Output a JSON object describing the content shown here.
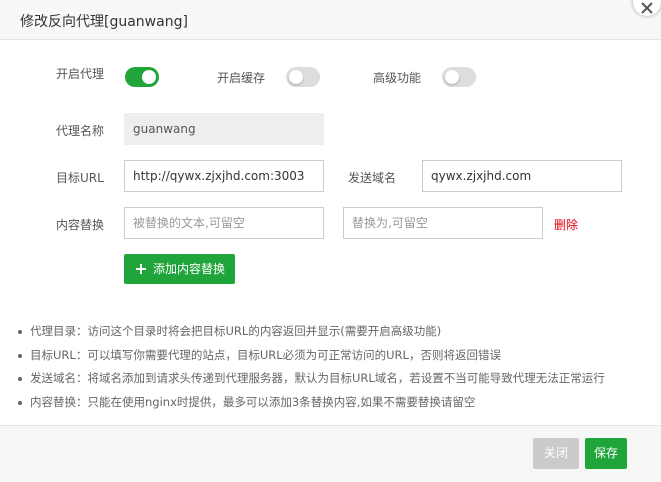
{
  "dialog": {
    "title": "修改反向代理[guanwang]"
  },
  "form": {
    "enable_proxy": {
      "label": "开启代理",
      "on": true
    },
    "enable_cache": {
      "label": "开启缓存",
      "on": false
    },
    "advanced": {
      "label": "高级功能",
      "on": false
    },
    "proxy_name": {
      "label": "代理名称",
      "value": "guanwang"
    },
    "target_url": {
      "label": "目标URL",
      "value": "http://qywx.zjxjhd.com:3003"
    },
    "send_domain": {
      "label": "发送域名",
      "value": "qywx.zjxjhd.com"
    },
    "content_replace": {
      "label": "内容替换",
      "source_placeholder": "被替换的文本,可留空",
      "target_placeholder": "替换为,可留空",
      "delete_label": "删除"
    },
    "add_button_label": "添加内容替换"
  },
  "notes": [
    "代理目录：访问这个目录时将会把目标URL的内容返回并显示(需要开启高级功能)",
    "目标URL：可以填写你需要代理的站点，目标URL必须为可正常访问的URL，否则将返回错误",
    "发送域名：将域名添加到请求头传递到代理服务器，默认为目标URL域名，若设置不当可能导致代理无法正常运行",
    "内容替换：只能在使用nginx时提供，最多可以添加3条替换内容,如果不需要替换请留空"
  ],
  "footer": {
    "close_label": "关闭",
    "save_label": "保存"
  },
  "colors": {
    "accent": "#20a53a",
    "danger": "#e60012",
    "disabled_button": "#cbcbcb"
  }
}
